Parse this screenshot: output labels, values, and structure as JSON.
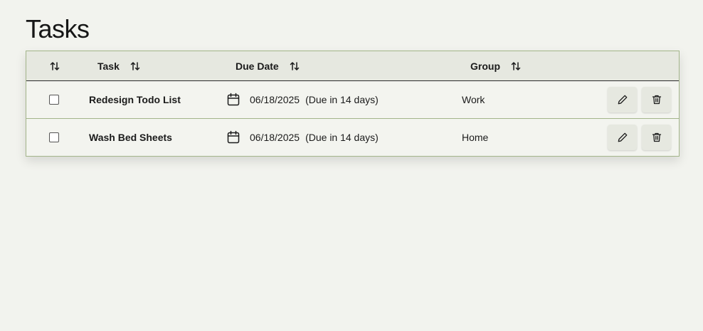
{
  "page": {
    "title": "Tasks"
  },
  "table": {
    "headers": {
      "task": "Task",
      "due_date": "Due Date",
      "group": "Group"
    },
    "rows": [
      {
        "task": "Redesign Todo List",
        "due_date": "06/18/2025",
        "due_relative": "(Due in 14 days)",
        "group": "Work",
        "checked": false
      },
      {
        "task": "Wash Bed Sheets",
        "due_date": "06/18/2025",
        "due_relative": "(Due in 14 days)",
        "group": "Home",
        "checked": false
      }
    ]
  },
  "icons": {
    "sort": "sort-arrows-icon",
    "calendar": "calendar-icon",
    "edit": "pencil-icon",
    "delete": "trash-icon"
  },
  "colors": {
    "background": "#f2f3ee",
    "header_background": "#e6e8e0",
    "border_accent": "#a3b58a"
  }
}
